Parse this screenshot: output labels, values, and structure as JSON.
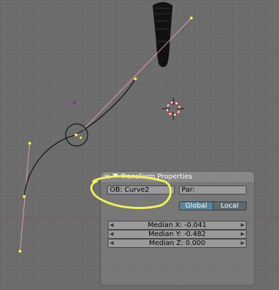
{
  "panel": {
    "title": "Transform Properties",
    "object_field": "OB: Curve2",
    "parent_field": "Par:",
    "global_label": "Global",
    "local_label": "Local",
    "active_space": "Global",
    "median_x": "Median X: -0.041",
    "median_y": "Median Y: -0.482",
    "median_z": "Median Z: 0.000"
  },
  "icons": {
    "close": "close-icon",
    "collapse": "collapse-triangle-icon",
    "spin_left": "arrow-left-icon",
    "spin_right": "arrow-right-icon"
  },
  "colors": {
    "viewport_bg": "#6d6d6d",
    "grid": "#5f5f5f",
    "handle_line": "#e89ab2",
    "control_point": "#f2f25a",
    "highlight": "#f2f25a",
    "red_axis": "#9a4a4a"
  }
}
